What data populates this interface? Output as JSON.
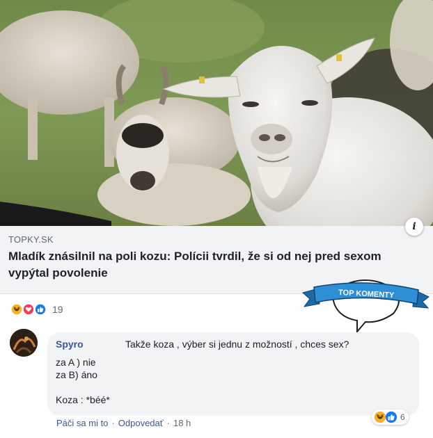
{
  "link_preview": {
    "domain": "TOPKY.SK",
    "title": "Mladík znásilnil na poli kozu: Polícii tvrdil, že si od nej pred sexom vypýtal povolenie",
    "info_label": "i"
  },
  "badge": {
    "text": "TOP KOMENTY",
    "ribbon_color": "#2d8fd5",
    "ribbon_dark": "#1a6aa8"
  },
  "post_reactions": {
    "types": [
      "haha-icon",
      "love-icon",
      "like-icon"
    ],
    "count": "19"
  },
  "comment": {
    "author": "Spyro",
    "line1": "Takže koza , výber si jednu z možností , chces sex?",
    "line2": "za A ) nie",
    "line3": "za B) áno",
    "line4": "Koza : *béé*",
    "reactions": {
      "types": [
        "haha-icon",
        "like-icon"
      ],
      "count": "6"
    },
    "actions": {
      "like": "Páči sa mi to",
      "reply": "Odpovedať",
      "time": "18 h"
    }
  },
  "colors": {
    "link_blue": "#385898",
    "like_blue": "#1877f2",
    "love_red": "#f33e58",
    "haha_yellow": "#f7b125"
  }
}
